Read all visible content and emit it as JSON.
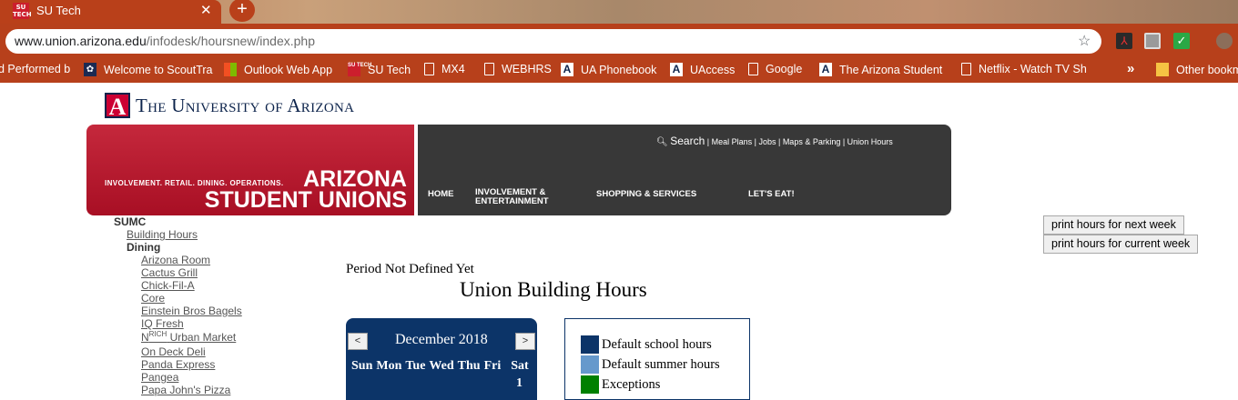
{
  "browser": {
    "tab_title": "SU Tech",
    "tab_icon_text": "SU TECH",
    "url_host": "www.union.arizona.edu",
    "url_path": "/infodesk/hoursnew/index.php",
    "bookmarks": [
      "d Performed b",
      "Welcome to ScoutTra",
      "Outlook Web App",
      "SU Tech",
      "MX4",
      "WEBHRS",
      "UA Phonebook",
      "UAccess",
      "Google",
      "The Arizona Student",
      "Netflix - Watch TV Sh",
      "Other bookm"
    ]
  },
  "site": {
    "university": "The University of Arizona",
    "logo_letter": "A",
    "tagline": "INVOLVEMENT. RETAIL. DINING. OPERATIONS.",
    "brand_line1": "ARIZONA",
    "brand_line2": "STUDENT UNIONS",
    "search_label": "Search",
    "utility_links": "| Meal Plans | Jobs | Maps & Parking | Union Hours",
    "nav": {
      "home": "HOME",
      "involvement": "INVOLVEMENT &",
      "entertainment": "ENTERTAINMENT",
      "shopping": "SHOPPING & SERVICES",
      "eat": "LET'S EAT!"
    }
  },
  "sidebar": {
    "sumc": "SUMC",
    "building_hours": "Building Hours",
    "dining": "Dining",
    "items": [
      "Arizona Room",
      "Cactus Grill",
      "Chick-Fil-A",
      "Core",
      "Einstein Bros Bagels",
      "IQ Fresh",
      "Urban Market",
      "On Deck Deli",
      "Panda Express",
      "Pangea",
      "Papa John's Pizza"
    ],
    "nrich_n": "N",
    "nrich_sup": "RICH"
  },
  "content": {
    "period": "Period Not Defined Yet",
    "title": "Union Building Hours",
    "print_next": "print hours for next week",
    "print_current": "print hours for current week"
  },
  "calendar": {
    "prev": "<",
    "next": ">",
    "month": "December 2018",
    "days": [
      "Sun",
      "Mon",
      "Tue",
      "Wed",
      "Thu",
      "Fri",
      "Sat"
    ],
    "first_date": "1"
  },
  "legend": {
    "items": [
      {
        "label": "Default school hours",
        "color": "#0c3468"
      },
      {
        "label": "Default summer hours",
        "color": "#6699cc"
      },
      {
        "label": "Exceptions",
        "color": "#008000"
      }
    ]
  },
  "colors": {
    "chrome": "#b7401b",
    "ua_red": "#cc0033",
    "ua_blue": "#0c234b",
    "banner_dark": "#383838"
  }
}
